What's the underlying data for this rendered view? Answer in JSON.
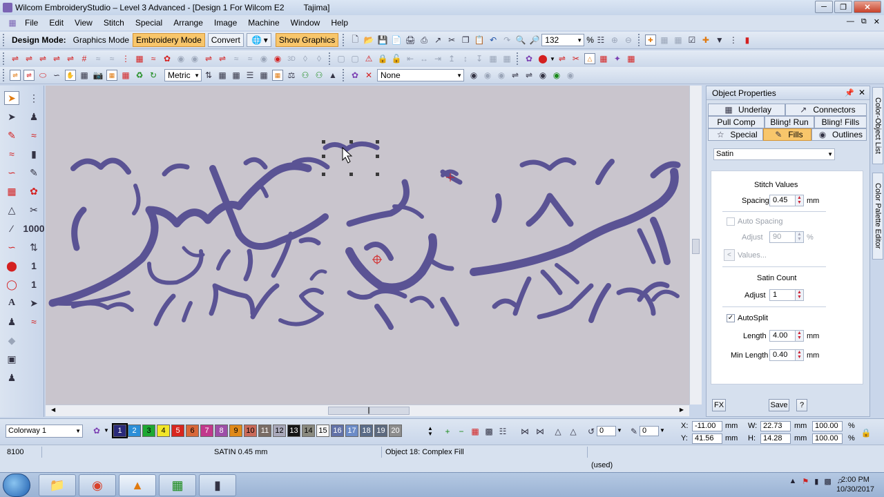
{
  "window": {
    "title": "Wilcom EmbroideryStudio – Level 3 Advanced - [Design 1 For Wilcom E2",
    "machine": "Tajima]"
  },
  "menu": [
    "File",
    "Edit",
    "View",
    "Stitch",
    "Special",
    "Arrange",
    "Image",
    "Machine",
    "Window",
    "Help"
  ],
  "toolbar1": {
    "design_mode_label": "Design Mode:",
    "graphics_mode": "Graphics Mode",
    "embroidery_mode": "Embroidery Mode",
    "convert": "Convert",
    "show_graphics": "Show Graphics",
    "zoom_value": "132",
    "zoom_unit": "%"
  },
  "toolbar3": {
    "units": "Metric",
    "stitch_type": "None"
  },
  "left_tools": {
    "num_1000": "1000",
    "num_1_a": "1",
    "num_1_b": "1"
  },
  "object_properties": {
    "title": "Object Properties",
    "tabs": {
      "underlay": "Underlay",
      "connectors": "Connectors",
      "pull_comp": "Pull Comp",
      "bling_run": "Bling! Run",
      "bling_fills": "Bling! Fills",
      "special": "Special",
      "fills": "Fills",
      "outlines": "Outlines"
    },
    "fill_type": "Satin",
    "stitch_values_heading": "Stitch Values",
    "spacing_label": "Spacing",
    "spacing_value": "0.45",
    "spacing_unit": "mm",
    "auto_spacing_label": "Auto Spacing",
    "adjust_label": "Adjust",
    "adjust_value": "90",
    "adjust_unit": "%",
    "values_button": "Values...",
    "satin_count_heading": "Satin Count",
    "satin_adjust_label": "Adjust",
    "satin_adjust_value": "1",
    "autosplit_label": "AutoSplit",
    "autosplit_checked": true,
    "length_label": "Length",
    "length_value": "4.00",
    "length_unit": "mm",
    "min_length_label": "Min Length",
    "min_length_value": "0.40",
    "min_length_unit": "mm",
    "fx_button": "FX",
    "save_button": "Save",
    "help_button": "?"
  },
  "side_tabs": [
    "Color-Object List",
    "Color Palette Editor"
  ],
  "colorway": {
    "selected": "Colorway 1",
    "swatches": [
      {
        "n": "1",
        "color": "#2a2a7a",
        "text": "#fff"
      },
      {
        "n": "2",
        "color": "#2c8fd8",
        "text": "#fff"
      },
      {
        "n": "3",
        "color": "#1da833",
        "text": "#000"
      },
      {
        "n": "4",
        "color": "#f2e629",
        "text": "#000"
      },
      {
        "n": "5",
        "color": "#d8261f",
        "text": "#fff"
      },
      {
        "n": "6",
        "color": "#d8683a",
        "text": "#000"
      },
      {
        "n": "7",
        "color": "#c2388c",
        "text": "#fff"
      },
      {
        "n": "8",
        "color": "#9e4fa8",
        "text": "#fff"
      },
      {
        "n": "9",
        "color": "#e08a1a",
        "text": "#000"
      },
      {
        "n": "10",
        "color": "#c96a5a",
        "text": "#000"
      },
      {
        "n": "11",
        "color": "#7a6d66",
        "text": "#fff"
      },
      {
        "n": "12",
        "color": "#a9a8ba",
        "text": "#000"
      },
      {
        "n": "13",
        "color": "#151515",
        "text": "#fff"
      },
      {
        "n": "14",
        "color": "#8a8a7f",
        "text": "#000"
      },
      {
        "n": "15",
        "color": "#f6f6f6",
        "text": "#000"
      },
      {
        "n": "16",
        "color": "#6272a8",
        "text": "#fff"
      },
      {
        "n": "17",
        "color": "#6c8cc8",
        "text": "#fff"
      },
      {
        "n": "18",
        "color": "#5a6c88",
        "text": "#fff"
      },
      {
        "n": "19",
        "color": "#5d6a7f",
        "text": "#fff"
      },
      {
        "n": "20",
        "color": "#8d8d8d",
        "text": "#fff"
      }
    ]
  },
  "rotation": {
    "angle1": "0",
    "angle2": "0"
  },
  "coords": {
    "x_label": "X:",
    "x_value": "-11.00",
    "x_unit": "mm",
    "y_label": "Y:",
    "y_value": "41.56",
    "y_unit": "mm",
    "w_label": "W:",
    "w_value": "22.73",
    "w_unit": "mm",
    "w_pct": "100.00",
    "h_label": "H:",
    "h_value": "14.28",
    "h_unit": "mm",
    "h_pct": "100.00",
    "pct": "%"
  },
  "status": {
    "stitches": "8100",
    "stitch_type": "SATIN  0.45 mm",
    "object": "Object 18: Complex Fill",
    "used": "(used)"
  },
  "clock": {
    "time": "2:00 PM",
    "date": "10/30/2017"
  },
  "colors": {
    "stitch": "#5a5394",
    "stitch_dark": "#3f3a78",
    "canvas": "#c9c5cd",
    "accent": "#f8c66b"
  }
}
